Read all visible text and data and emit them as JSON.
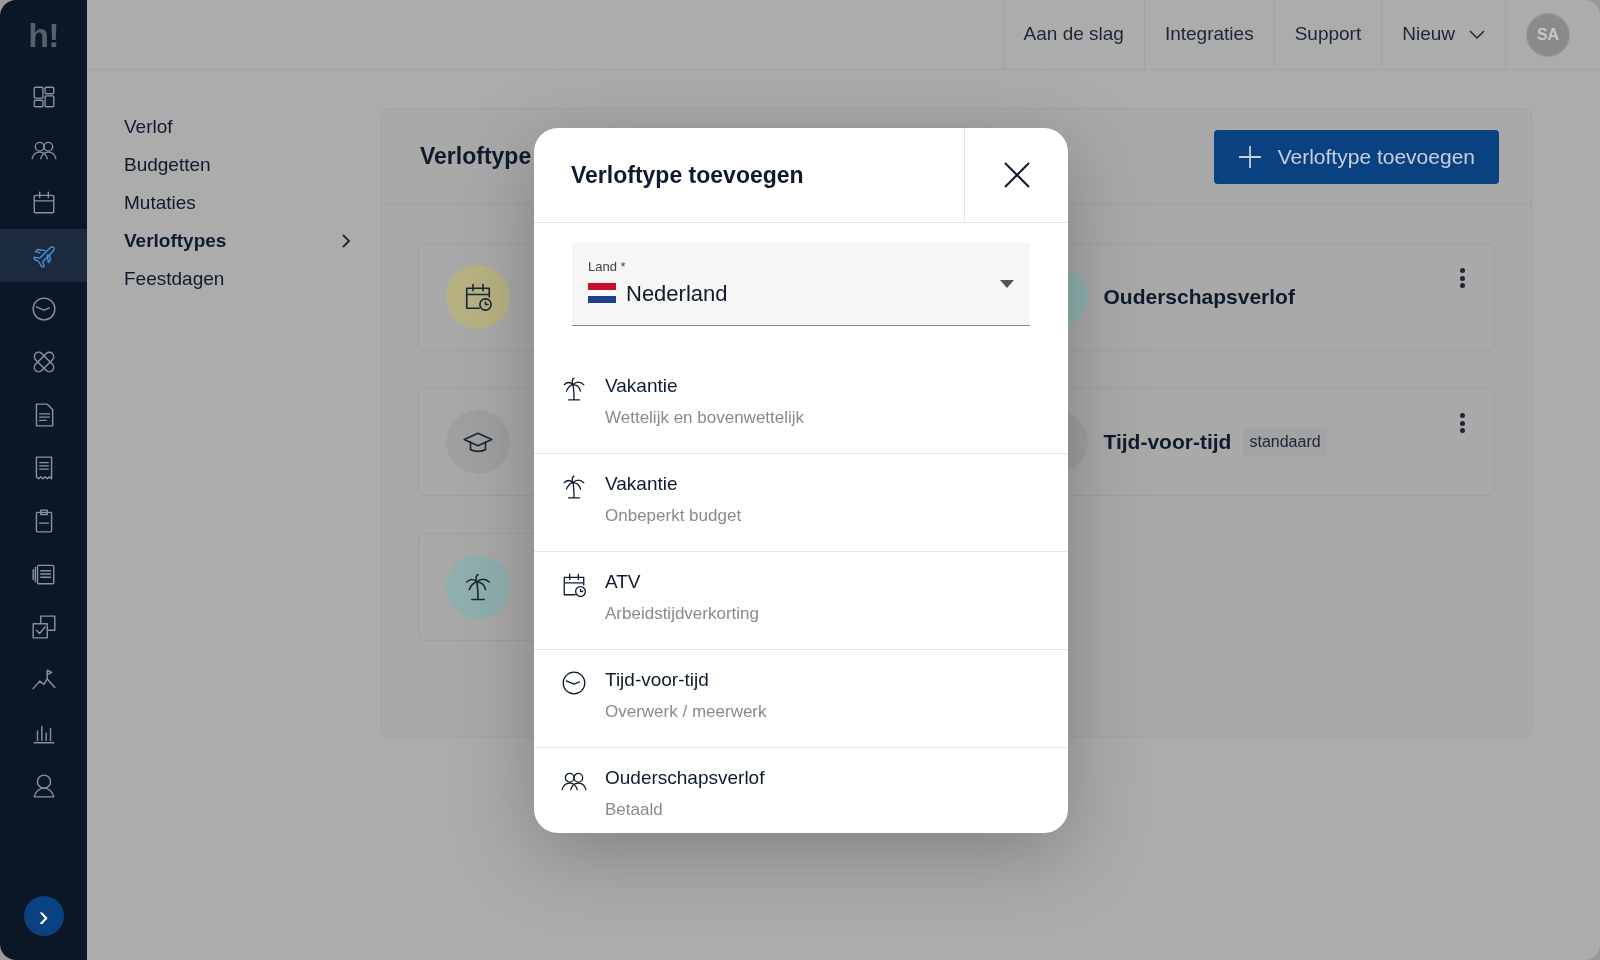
{
  "logo": "h!",
  "sidebar": {
    "items": [
      {
        "kind": "dashboard",
        "selected": false
      },
      {
        "kind": "people",
        "selected": false
      },
      {
        "kind": "calendar",
        "selected": false
      },
      {
        "kind": "plane",
        "selected": true
      },
      {
        "kind": "clock",
        "selected": false
      },
      {
        "kind": "bandage",
        "selected": false
      },
      {
        "kind": "document",
        "selected": false
      },
      {
        "kind": "receipt",
        "selected": false
      },
      {
        "kind": "clipboard",
        "selected": false
      },
      {
        "kind": "files",
        "selected": false
      },
      {
        "kind": "checkbox",
        "selected": false
      },
      {
        "kind": "mountain",
        "selected": false
      },
      {
        "kind": "chart",
        "selected": false
      },
      {
        "kind": "person",
        "selected": false
      }
    ],
    "expand_button": "›"
  },
  "topbar": {
    "links": [
      {
        "label": "Aan de slag",
        "dropdown": false
      },
      {
        "label": "Integraties",
        "dropdown": false
      },
      {
        "label": "Support",
        "dropdown": false
      },
      {
        "label": "Nieuw",
        "dropdown": true
      }
    ],
    "avatar": "SA"
  },
  "subnav": [
    {
      "label": "Verlof",
      "selected": false
    },
    {
      "label": "Budgetten",
      "selected": false
    },
    {
      "label": "Mutaties",
      "selected": false
    },
    {
      "label": "Verloftypes",
      "selected": true
    },
    {
      "label": "Feestdagen",
      "selected": false
    }
  ],
  "panel": {
    "title": "Verloftype",
    "add_button": "Verloftype toevoegen",
    "cards": [
      {
        "kind": "calendar-clock",
        "color": "#b8b283",
        "menu": false
      },
      {
        "title": "Ouderschapsverlof",
        "color": "#8fb0ae",
        "menu": true
      },
      {
        "kind": "graduation",
        "color": "#a0a0a0",
        "menu": false
      },
      {
        "title": "Tijd-voor-tijd",
        "color": "#a0a0a0",
        "badge": "standaard",
        "menu": true
      },
      {
        "kind": "palm",
        "color": "#8fb0ae",
        "menu": false
      }
    ]
  },
  "modal": {
    "title": "Verloftype toevoegen",
    "country_field": {
      "label": "Land *",
      "value": "Nederland"
    },
    "options": [
      {
        "kind": "palm",
        "title": "Vakantie",
        "subtitle": "Wettelijk en bovenwettelijk"
      },
      {
        "kind": "palm",
        "title": "Vakantie",
        "subtitle": "Onbeperkt budget"
      },
      {
        "kind": "calendar-clock",
        "title": "ATV",
        "subtitle": "Arbeidstijdverkorting"
      },
      {
        "kind": "clock",
        "title": "Tijd-voor-tijd",
        "subtitle": "Overwerk / meerwerk"
      },
      {
        "kind": "people",
        "title": "Ouderschapsverlof",
        "subtitle": "Betaald"
      }
    ]
  }
}
